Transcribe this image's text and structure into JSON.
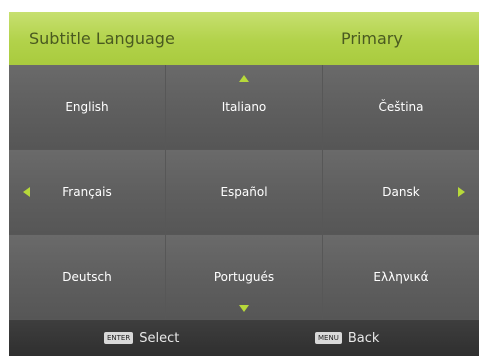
{
  "header": {
    "title": "Subtitle Language",
    "value": "Primary"
  },
  "languages": [
    "English",
    "Italiano",
    "Čeština",
    "Français",
    "Español",
    "Dansk",
    "Deutsch",
    "Portugués",
    "Ελληνικά"
  ],
  "footer": {
    "select_key": "ENTER",
    "select_label": "Select",
    "back_key": "MENU",
    "back_label": "Back"
  },
  "colors": {
    "header_bg": "#b2d24a",
    "cell_bg": "#5f5f5f",
    "grid_lines": "#575757",
    "accent_arrow": "#b7d93a",
    "footer_bg": "#333333",
    "text": "#ffffff"
  }
}
